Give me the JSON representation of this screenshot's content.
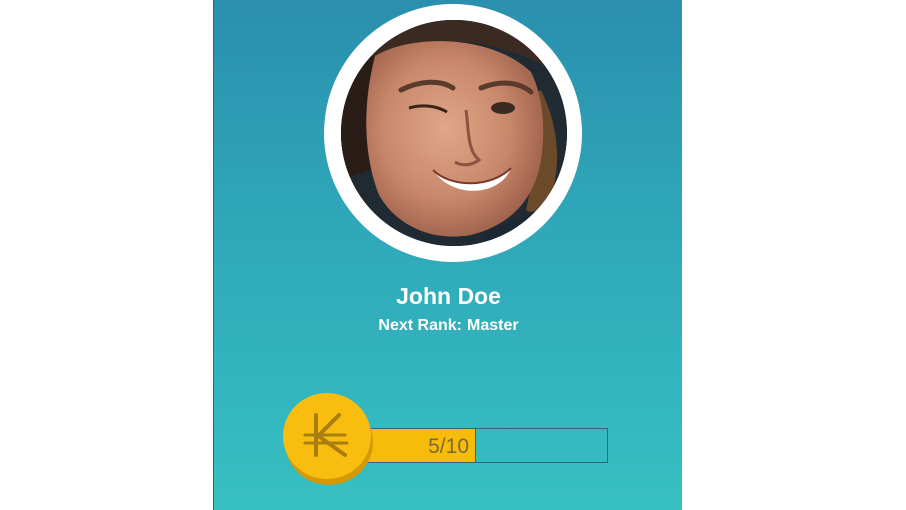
{
  "profile": {
    "name": "John Doe",
    "next_rank_label": "Next Rank:",
    "next_rank_value": "Master"
  },
  "progress": {
    "text": "5/10",
    "current": 5,
    "total": 10,
    "fraction": 0.5
  },
  "coin": {
    "icon": "kip-currency-icon"
  },
  "colors": {
    "card_top": "#2a8fae",
    "card_bottom": "#36c0c3",
    "coin": "#f8bd0e",
    "progress_fill": "#f7bb0a",
    "text": "#ffffff"
  }
}
